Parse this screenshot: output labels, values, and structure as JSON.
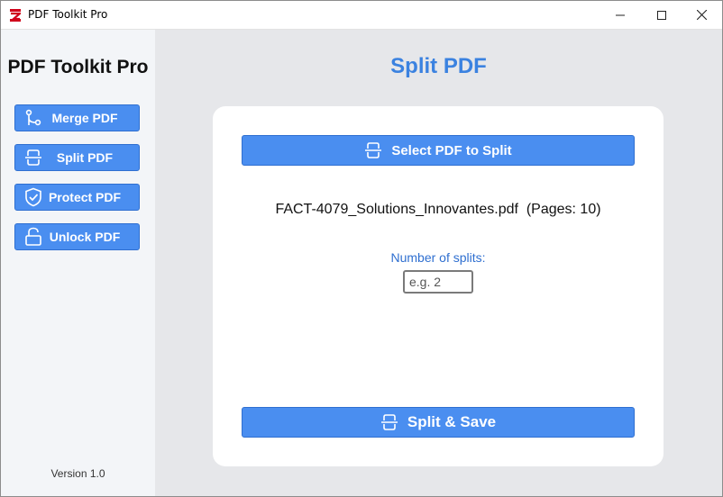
{
  "window": {
    "title": "PDF Toolkit Pro",
    "controls": {
      "minimize": "minimize-icon",
      "maximize": "maximize-icon",
      "close": "close-icon"
    }
  },
  "sidebar": {
    "brand": "PDF Toolkit Pro",
    "items": [
      {
        "label": "Merge PDF",
        "icon": "merge-icon"
      },
      {
        "label": "Split PDF",
        "icon": "split-icon"
      },
      {
        "label": "Protect PDF",
        "icon": "shield-icon"
      },
      {
        "label": "Unlock PDF",
        "icon": "unlock-icon"
      }
    ],
    "version": "Version 1.0"
  },
  "main": {
    "title": "Split PDF",
    "select_button": "Select PDF to Split",
    "file_info": "FACT-4079_Solutions_Innovantes.pdf  (Pages: 10)",
    "splits_label": "Number of splits:",
    "splits_input": {
      "value": "",
      "placeholder": "e.g. 2"
    },
    "save_button": "Split & Save"
  },
  "colors": {
    "accent": "#4a8ef0",
    "accent_border": "#2f6fd0",
    "title_blue": "#3b82e0",
    "sidebar_bg": "#f3f5f8",
    "main_bg": "#e6e7ea",
    "card_bg": "#ffffff"
  }
}
